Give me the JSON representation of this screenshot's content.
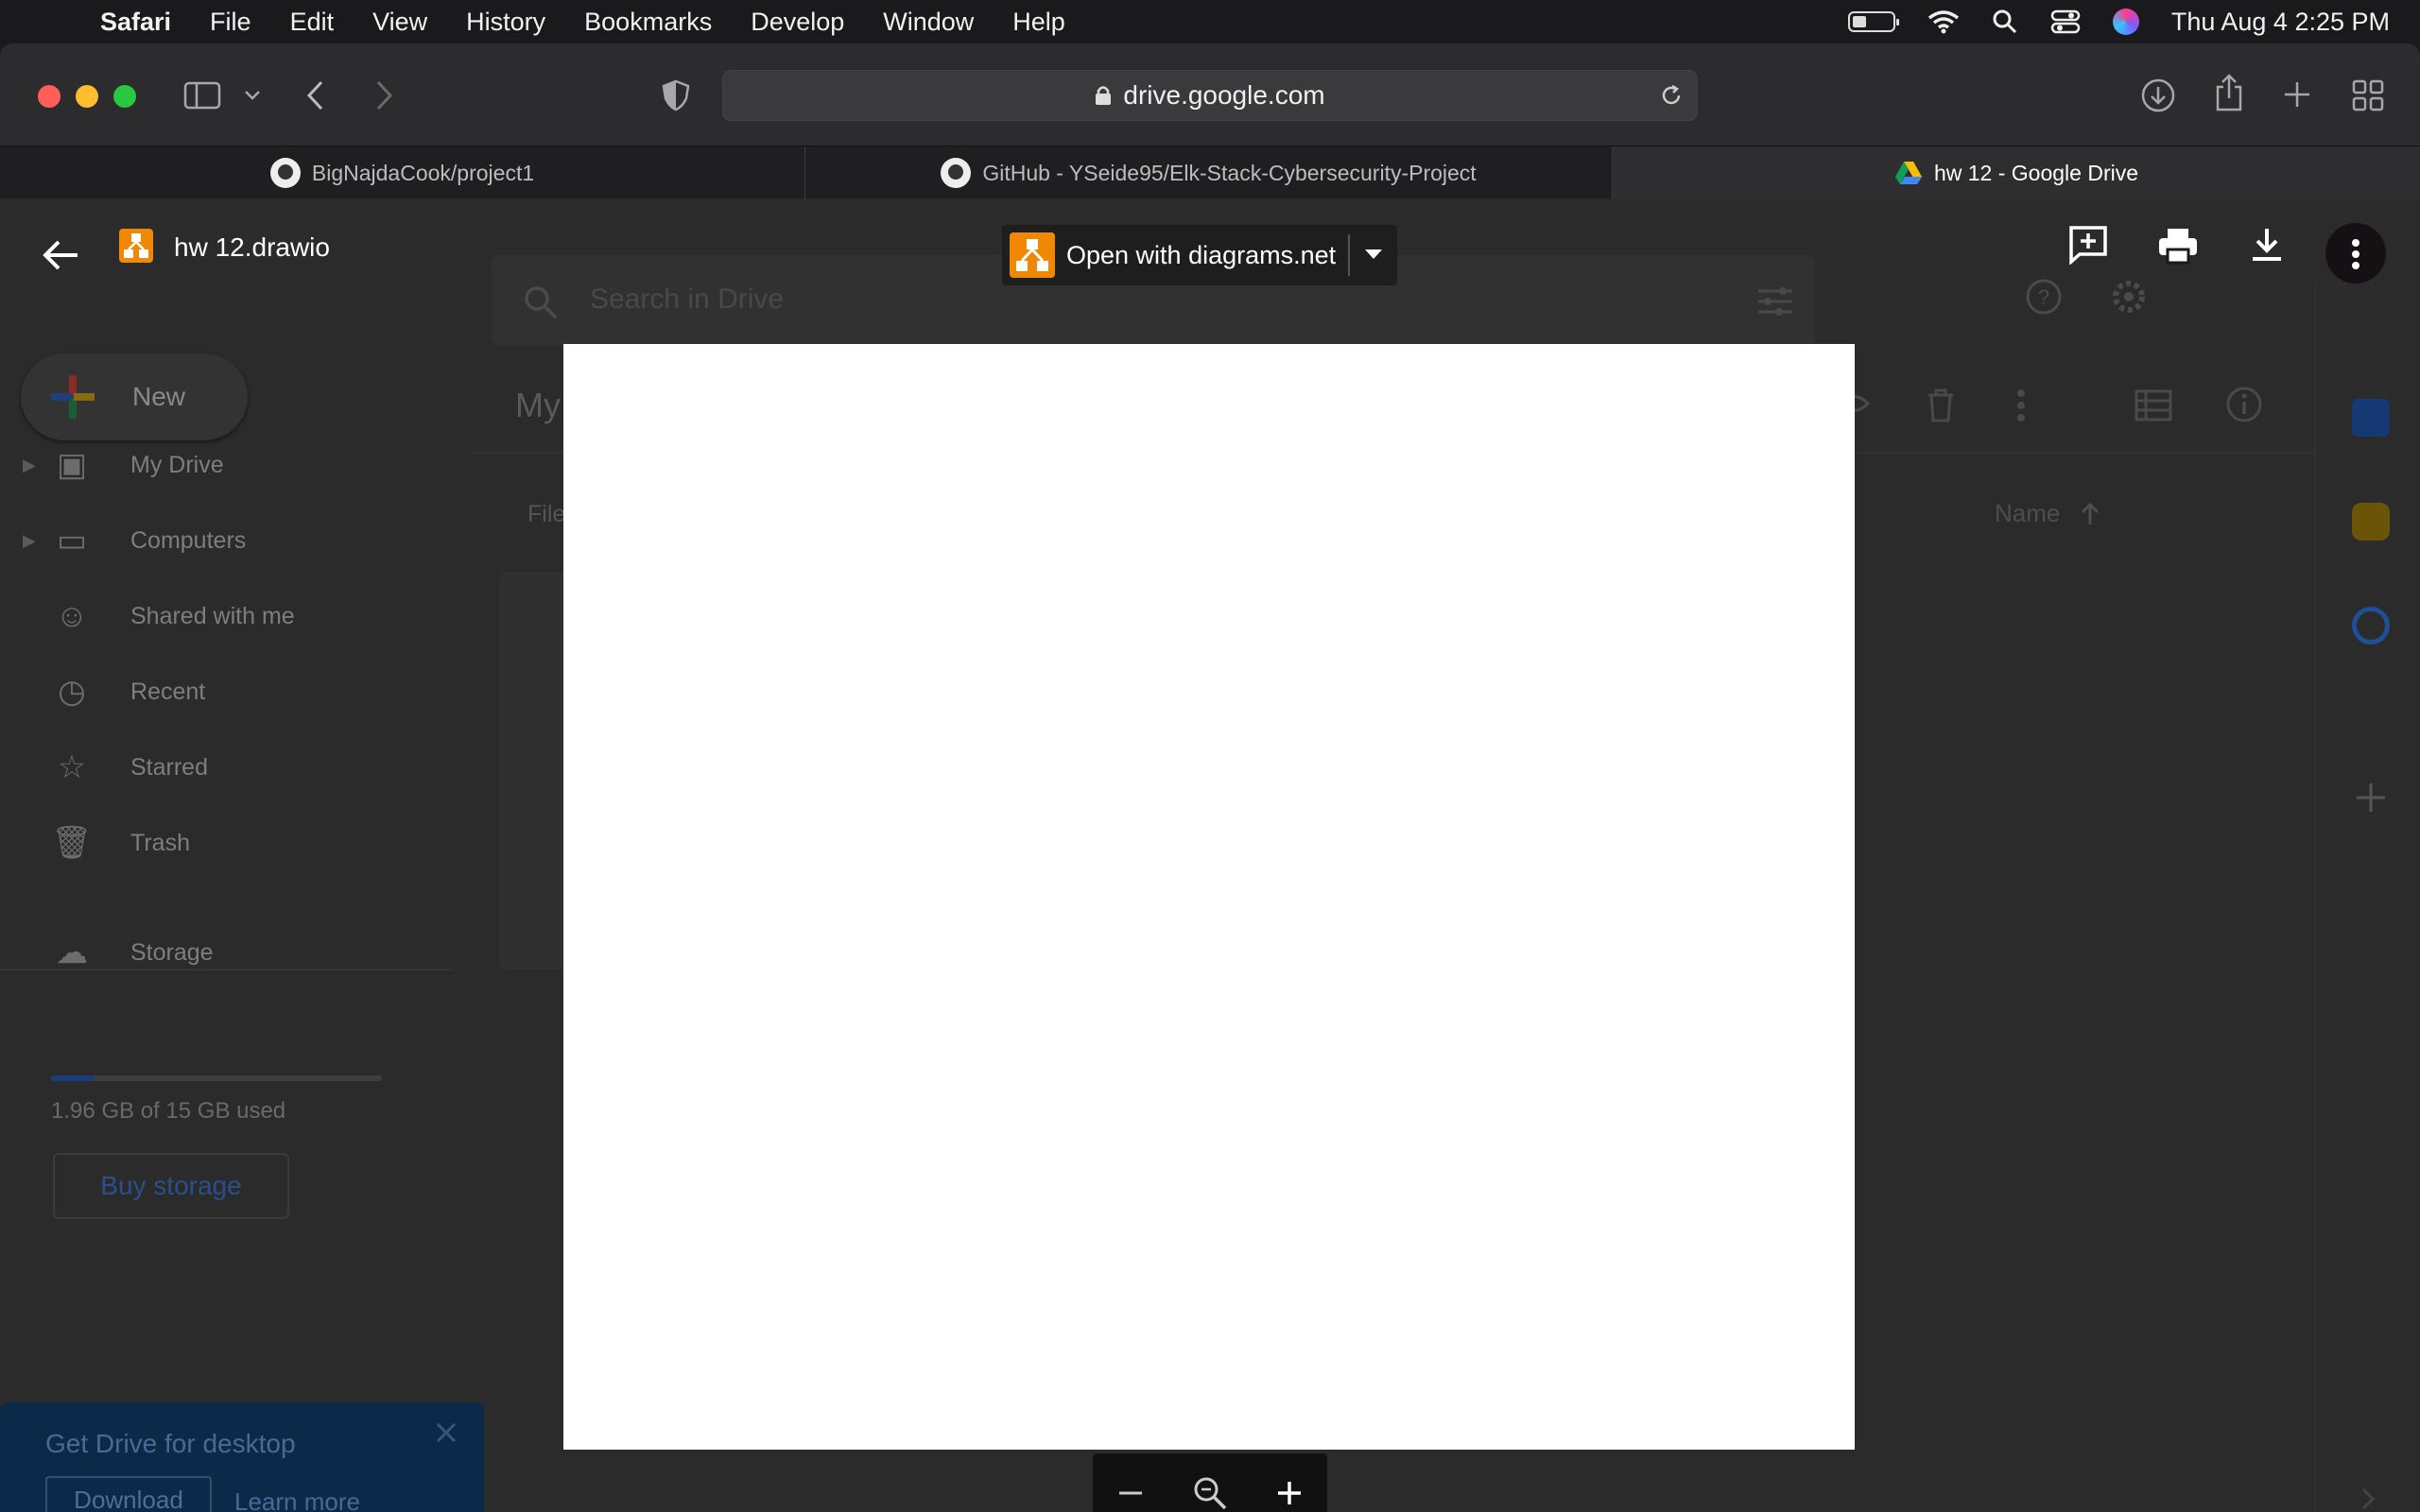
{
  "menubar": {
    "app": "Safari",
    "items": [
      "File",
      "Edit",
      "View",
      "History",
      "Bookmarks",
      "Develop",
      "Window",
      "Help"
    ],
    "clock": "Thu Aug 4  2:25 PM"
  },
  "browser": {
    "url": "drive.google.com",
    "tabs": [
      {
        "title": "BigNajdaCook/project1"
      },
      {
        "title": "GitHub - YSeide95/Elk-Stack-Cybersecurity-Project"
      },
      {
        "title": "hw 12 - Google Drive"
      }
    ]
  },
  "drive": {
    "search_placeholder": "Search in Drive",
    "new_label": "New",
    "header_partial": "My",
    "files_partial": "File",
    "sort_label": "Name",
    "sidebar": [
      {
        "label": "My Drive",
        "icon": "my-drive-icon"
      },
      {
        "label": "Computers",
        "icon": "computer-icon"
      },
      {
        "label": "Shared with me",
        "icon": "people-icon"
      },
      {
        "label": "Recent",
        "icon": "clock-icon"
      },
      {
        "label": "Starred",
        "icon": "star-icon"
      },
      {
        "label": "Trash",
        "icon": "trash-icon"
      }
    ],
    "storage_label": "Storage",
    "storage_used_text": "1.96 GB of 15 GB used",
    "storage_fraction": 0.13,
    "buy_storage": "Buy storage",
    "promo": {
      "title": "Get Drive for desktop",
      "download": "Download",
      "learn_more": "Learn more"
    }
  },
  "viewer": {
    "filename": "hw 12.drawio",
    "open_with": "Open with diagrams.net"
  },
  "colors": {
    "drawio_orange": "#f08705",
    "accent_blue": "#1a73e8"
  }
}
